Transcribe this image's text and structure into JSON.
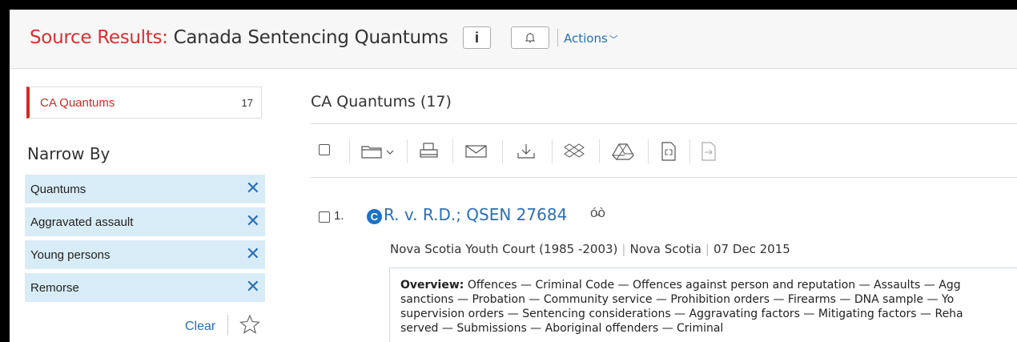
{
  "header": {
    "title_label": "Source Results:",
    "title_text": " Canada Sentencing Quantums",
    "info_button_label": "i",
    "actions_label": "Actions",
    "actions_icon": "chevron-down-icon"
  },
  "sidebar": {
    "source": {
      "name": "CA Quantums",
      "count": "17"
    },
    "narrow_by_label": "Narrow By",
    "filters": [
      {
        "label": "Quantums"
      },
      {
        "label": "Aggravated assault"
      },
      {
        "label": "Young persons"
      },
      {
        "label": "Remorse"
      }
    ],
    "clear_label": "Clear"
  },
  "main": {
    "results_title": "CA Quantums (17)",
    "toolbar_icons": [
      "select-all-checkbox",
      "folder-icon",
      "print-icon",
      "email-icon",
      "download-icon",
      "dropbox-icon",
      "google-drive-icon",
      "copy-citation-icon",
      "send-to-icon"
    ],
    "result": {
      "number": "1.",
      "badge": "C",
      "title": "R. v. R.D.; QSEN 27684",
      "meta": [
        "Nova Scotia Youth Court (1985 -2003)",
        "Nova Scotia",
        "07 Dec 2015"
      ],
      "overview_label": "Overview:",
      "overview_lines": [
        " Offences — Criminal Code — Offences against person and reputation — Assaults — Agg",
        "sanctions — Probation — Community service — Prohibition orders — Firearms — DNA sample — Yo",
        "supervision orders — Sentencing considerations — Aggravating factors — Mitigating factors — Reha",
        "served — Submissions — Aboriginal offenders — Criminal"
      ]
    }
  },
  "colors": {
    "accent_red": "#d63232",
    "link_blue": "#2b6fb6",
    "filter_bg": "#d8ecf7"
  }
}
